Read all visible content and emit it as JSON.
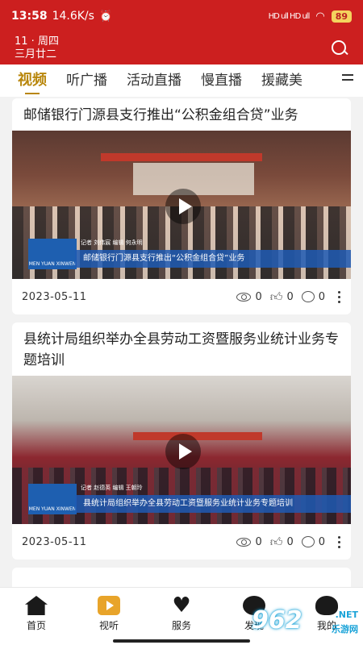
{
  "status_bar": {
    "time": "13:58",
    "speed": "14.6K/s",
    "signal": "HD ull HD ull",
    "battery": "89"
  },
  "header": {
    "date_line1": "11 · 周四",
    "date_line2": "三月廿二"
  },
  "tabs": [
    {
      "label": "视频",
      "active": true
    },
    {
      "label": "听广播",
      "active": false
    },
    {
      "label": "活动直播",
      "active": false
    },
    {
      "label": "慢直播",
      "active": false
    },
    {
      "label": "援藏美",
      "active": false
    }
  ],
  "feed": [
    {
      "title": "邮储银行门源县支行推出“公积金组合贷”业务",
      "caption": "邮储银行门源县支行推出“公积金组合贷”业务",
      "credit": "记者 刘伟宸 编辑 何永明",
      "logo_text": "MEN YUAN XINWEN",
      "date": "2023-05-11",
      "views": "0",
      "likes": "0",
      "comments": "0"
    },
    {
      "title": "县统计局组织举办全县劳动工资暨服务业统计业务专题培训",
      "caption": "县统计局组织举办全县劳动工资暨服务业统计业务专题培训",
      "credit": "记者 赵德英 编辑 王朝玲",
      "logo_text": "MEN YUAN XINWEN",
      "date": "2023-05-11",
      "views": "0",
      "likes": "0",
      "comments": "0"
    }
  ],
  "bottom_nav": [
    {
      "label": "首页",
      "icon": "home-icon"
    },
    {
      "label": "视听",
      "icon": "play-icon"
    },
    {
      "label": "服务",
      "icon": "heart-icon"
    },
    {
      "label": "发现",
      "icon": "discover-icon"
    },
    {
      "label": "我的",
      "icon": "user-icon"
    }
  ],
  "watermark": {
    "logo": "962",
    "text_line1": ".NET",
    "text_line2": "乐游网"
  }
}
